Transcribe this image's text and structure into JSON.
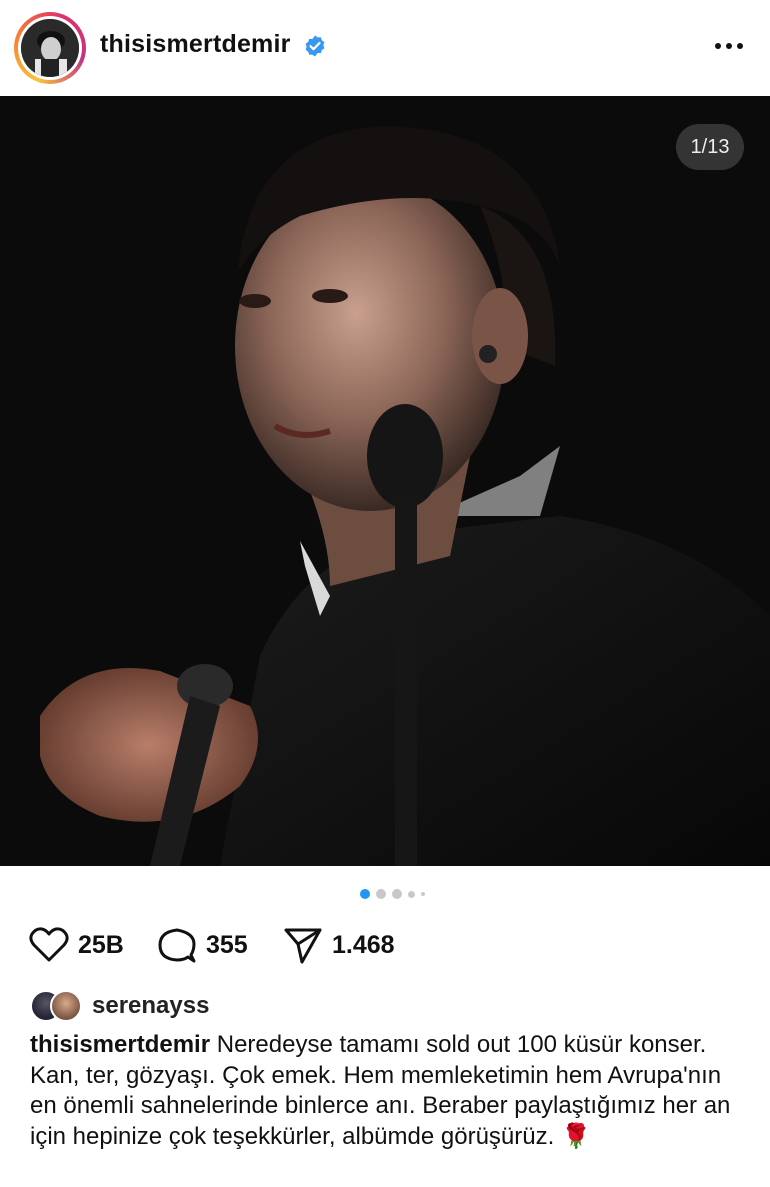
{
  "post": {
    "username": "thisismertdemir",
    "verified": true,
    "image_counter": "1/13",
    "slide_dots": 5,
    "active_dot": 0
  },
  "actions": {
    "likes": "25B",
    "comments": "355",
    "shares": "1.468"
  },
  "liked_by": {
    "username": "serenayss"
  },
  "caption": {
    "username": "thisismertdemir",
    "text": "Neredeyse tamamı sold out 100 küsür konser. Kan, ter, gözyaşı. Çok emek. Hem memleketimin hem Avrupa'nın en önemli sahnelerinde binlerce anı. Beraber paylaştığımız her an için hepinize çok teşekkürler, albümde görüşürüz.",
    "emoji": "🌹"
  },
  "icons": {
    "verified": "verified-badge-icon",
    "more": "more-options-icon",
    "like": "heart-icon",
    "comment": "comment-bubble-icon",
    "share": "send-icon"
  },
  "colors": {
    "verified_blue": "#3897f0",
    "active_dot": "#2196f3"
  }
}
